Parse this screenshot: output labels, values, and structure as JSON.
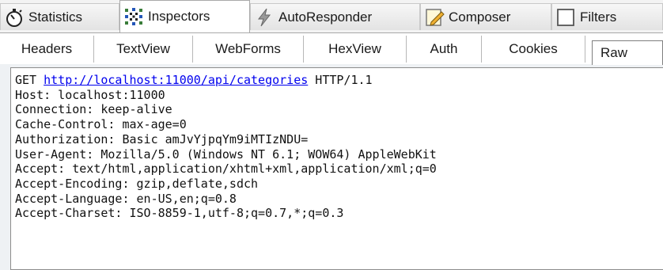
{
  "main_tabs": [
    {
      "label": "Statistics",
      "icon": "stopwatch-icon"
    },
    {
      "label": "Inspectors",
      "icon": "inspectors-icon",
      "active": true
    },
    {
      "label": "AutoResponder",
      "icon": "lightning-icon"
    },
    {
      "label": "Composer",
      "icon": "pencil-icon"
    },
    {
      "label": "Filters",
      "icon": "checkbox-icon"
    }
  ],
  "sub_tabs": [
    "Headers",
    "TextView",
    "WebForms",
    "HexView",
    "Auth",
    "Cookies",
    "Raw"
  ],
  "active_sub_tab": "Raw",
  "request": {
    "method": "GET",
    "url": "http://localhost:11000/api/categories",
    "version": "HTTP/1.1",
    "headers": [
      "Host: localhost:11000",
      "Connection: keep-alive",
      "Cache-Control: max-age=0",
      "Authorization: Basic amJvYjpqYm9iMTIzNDU=",
      "User-Agent: Mozilla/5.0 (Windows NT 6.1; WOW64) AppleWebKit",
      "Accept: text/html,application/xhtml+xml,application/xml;q=0",
      "Accept-Encoding: gzip,deflate,sdch",
      "Accept-Language: en-US,en;q=0.8",
      "Accept-Charset: ISO-8859-1,utf-8;q=0.7,*;q=0.3"
    ]
  },
  "colors": {
    "link": "#0000ee",
    "pane_bg": "#eef1f4"
  }
}
